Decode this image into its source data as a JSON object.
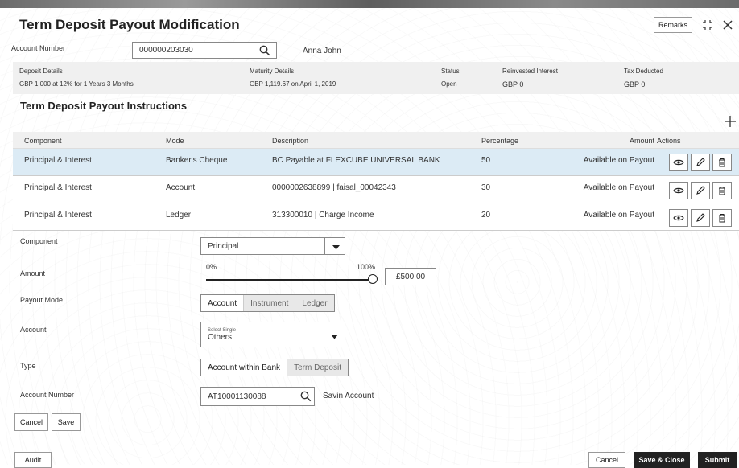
{
  "page": {
    "title": "Term Deposit Payout Modification"
  },
  "header_buttons": {
    "remarks": "Remarks"
  },
  "account": {
    "label": "Account Number",
    "value": "000000203030",
    "customer_name": "Anna John"
  },
  "summary": {
    "deposit_details_label": "Deposit Details",
    "deposit_details_value": "GBP 1,000 at 12% for 1 Years 3 Months",
    "maturity_details_label": "Maturity Details",
    "maturity_details_value": "GBP 1,119.67 on April 1, 2019",
    "status_label": "Status",
    "status_value": "Open",
    "reinvested_label": "Reinvested Interest",
    "reinvested_value": "GBP 0",
    "tax_label": "Tax Deducted",
    "tax_value": "GBP 0"
  },
  "section": {
    "title": "Term Deposit Payout Instructions"
  },
  "table": {
    "headers": {
      "component": "Component",
      "mode": "Mode",
      "description": "Description",
      "percentage": "Percentage",
      "amount": "Amount",
      "actions": "Actions"
    },
    "rows": [
      {
        "component": "Principal & Interest",
        "mode": "Banker's Cheque",
        "description": "BC Payable at FLEXCUBE UNIVERSAL BANK",
        "percentage": "50",
        "amount": "Available on Payout"
      },
      {
        "component": "Principal & Interest",
        "mode": "Account",
        "description": "0000002638899 | faisal_00042343",
        "percentage": "30",
        "amount": "Available on Payout"
      },
      {
        "component": "Principal & Interest",
        "mode": "Ledger",
        "description": "313300010 | Charge Income",
        "percentage": "20",
        "amount": "Available on Payout"
      }
    ]
  },
  "form": {
    "component_label": "Component",
    "component_value": "Principal",
    "amount_label": "Amount",
    "slider_min": "0%",
    "slider_max": "100%",
    "slider_level": 1.0,
    "amount_value": "£500.00",
    "payout_mode_label": "Payout Mode",
    "payout_modes": [
      "Account",
      "Instrument",
      "Ledger"
    ],
    "account_label": "Account",
    "account_select_hint": "Select Single",
    "account_select_value": "Others",
    "type_label": "Type",
    "types": [
      "Account within Bank",
      "Term Deposit"
    ],
    "account_number_label": "Account Number",
    "account_number_value": "AT10001130088",
    "account_holder": "Savin Account",
    "cancel": "Cancel",
    "save": "Save"
  },
  "footer": {
    "audit": "Audit",
    "cancel": "Cancel",
    "save_close": "Save & Close",
    "submit": "Submit"
  },
  "colors": {
    "selected_row": "#dcebf5",
    "header_bg": "#f0f0f0",
    "primary_dark": "#222222"
  }
}
